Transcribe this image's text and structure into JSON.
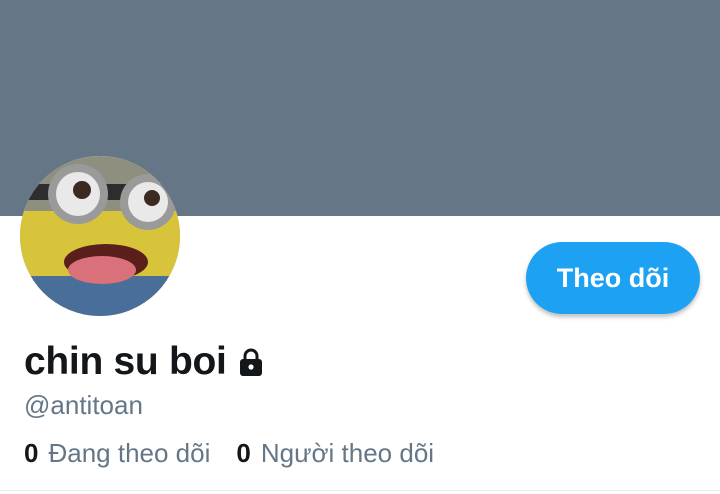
{
  "profile": {
    "display_name": "chin su boi",
    "handle": "@antitoan",
    "protected_icon": "lock-icon",
    "avatar_icon": "minion-avatar",
    "follow_button_label": "Theo dõi",
    "stats": {
      "following_count": "0",
      "following_label": "Đang theo dõi",
      "followers_count": "0",
      "followers_label": "Người theo dõi"
    }
  },
  "colors": {
    "banner": "#657786",
    "accent": "#1da1f2",
    "text_primary": "#14171a",
    "text_secondary": "#657786"
  }
}
